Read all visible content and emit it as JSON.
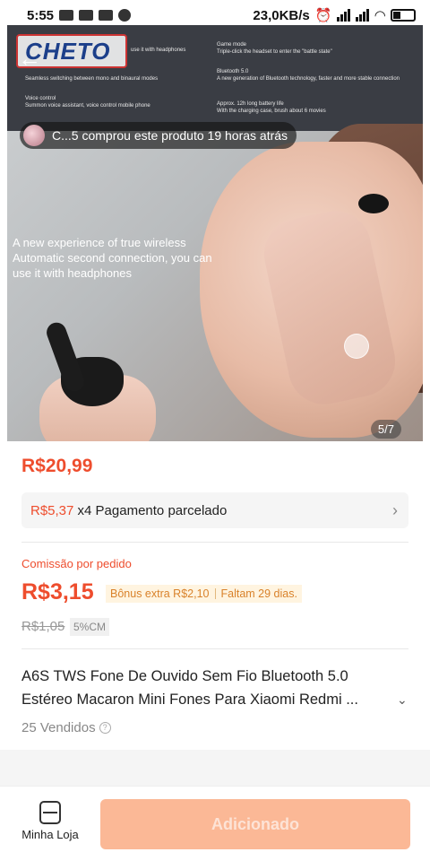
{
  "status_bar": {
    "time": "5:55",
    "speed": "23,0KB/s"
  },
  "hero": {
    "logo_text": "CHETO",
    "features": [
      "Seamless switching between mono and binaural modes",
      "Voice control",
      "Summon voice assistant, voice control mobile phone",
      "Game mode",
      "Triple-click the headset to enter the \"battle state\"",
      "Bluetooth 5.0",
      "A new generation of Bluetooth technology, faster and more stable connection",
      "Approx. 12h long battery life",
      "With the charging case, brush about 6 movies"
    ],
    "feature_top": "use it with headphones",
    "purchase_text": "C...5 comprou este produto 19 horas atrás",
    "caption": "A new experience of true wireless Automatic second connection, you can use it with headphones",
    "counter": "5/7"
  },
  "price": {
    "main": "R$20,99"
  },
  "installments": {
    "price": "R$5,37",
    "text": " x4 Pagamento parcelado"
  },
  "commission": {
    "label": "Comissão por pedido",
    "value": "R$3,15",
    "bonus": "Bônus extra R$2,10",
    "remaining": "Faltam 29 dias.",
    "old_value": "R$1,05",
    "percent": "5%CM"
  },
  "product": {
    "title": "A6S TWS Fone De Ouvido Sem Fio Bluetooth 5.0 Estéreo Macaron Mini Fones Para Xiaomi Redmi ...",
    "sold": "25 Vendidos"
  },
  "bottom": {
    "store_label": "Minha Loja",
    "add_label": "Adicionado"
  }
}
